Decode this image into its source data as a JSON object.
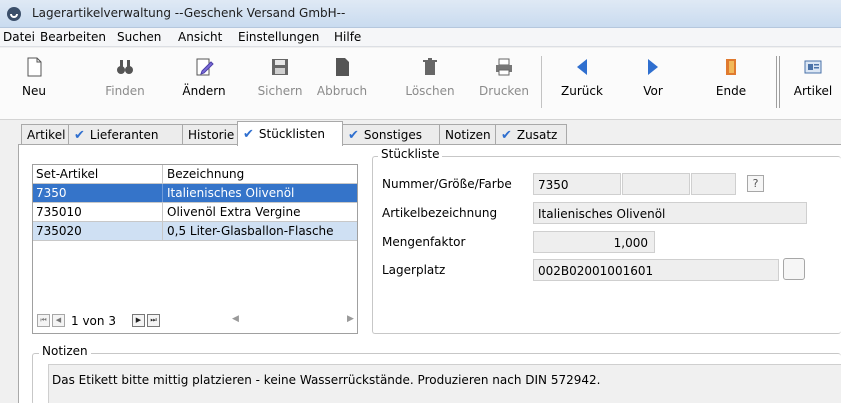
{
  "window": {
    "title": "Lagerartikelverwaltung --Geschenk Versand GmbH--",
    "icon": "app-logo-icon"
  },
  "menu": [
    "Datei",
    "Bearbeiten",
    "Suchen",
    "Ansicht",
    "Einstellungen",
    "Hilfe"
  ],
  "toolbar": {
    "neu": "Neu",
    "finden": "Finden",
    "aendern": "Ändern",
    "sichern": "Sichern",
    "abbruch": "Abbruch",
    "loeschen": "Löschen",
    "drucken": "Drucken",
    "zurueck": "Zurück",
    "vor": "Vor",
    "ende": "Ende",
    "artikel": "Artikel"
  },
  "tabs": {
    "artikel": "Artikel",
    "lieferanten": "Lieferanten",
    "historie": "Historie",
    "stuecklisten": "Stücklisten",
    "sonstiges": "Sonstiges",
    "notizen": "Notizen",
    "zusatz": "Zusatz",
    "active": "Stücklisten"
  },
  "set_grid": {
    "columns": [
      "Set-Artikel",
      "Bezeichnung"
    ],
    "rows": [
      {
        "nr": "7350",
        "name": "Italienisches Olivenöl",
        "selected": true
      },
      {
        "nr": "735010",
        "name": "Olivenöl Extra Vergine"
      },
      {
        "nr": "735020",
        "name": "0,5 Liter-Glasballon-Flasche"
      }
    ],
    "pager": "1 von 3"
  },
  "stueckliste": {
    "group_label": "Stückliste",
    "nummer_label": "Nummer/Größe/Farbe",
    "nummer_value": "7350",
    "bezeichnung_label": "Artikelbezeichnung",
    "bezeichnung_value": "Italienisches Olivenöl",
    "menge_label": "Mengenfaktor",
    "menge_value": "1,000",
    "lager_label": "Lagerplatz",
    "lager_value": "002B02001001601",
    "help_button": "?"
  },
  "notizen": {
    "label": "Notizen",
    "text": "Das Etikett bitte mittig platzieren - keine Wasserrückstände. Produzieren nach DIN 572942."
  },
  "colors": {
    "selection": "#3574c9",
    "alt_row": "#cfe0f3",
    "nav_arrow": "#2f6fcf",
    "tab_check": "#2f6fcf"
  }
}
